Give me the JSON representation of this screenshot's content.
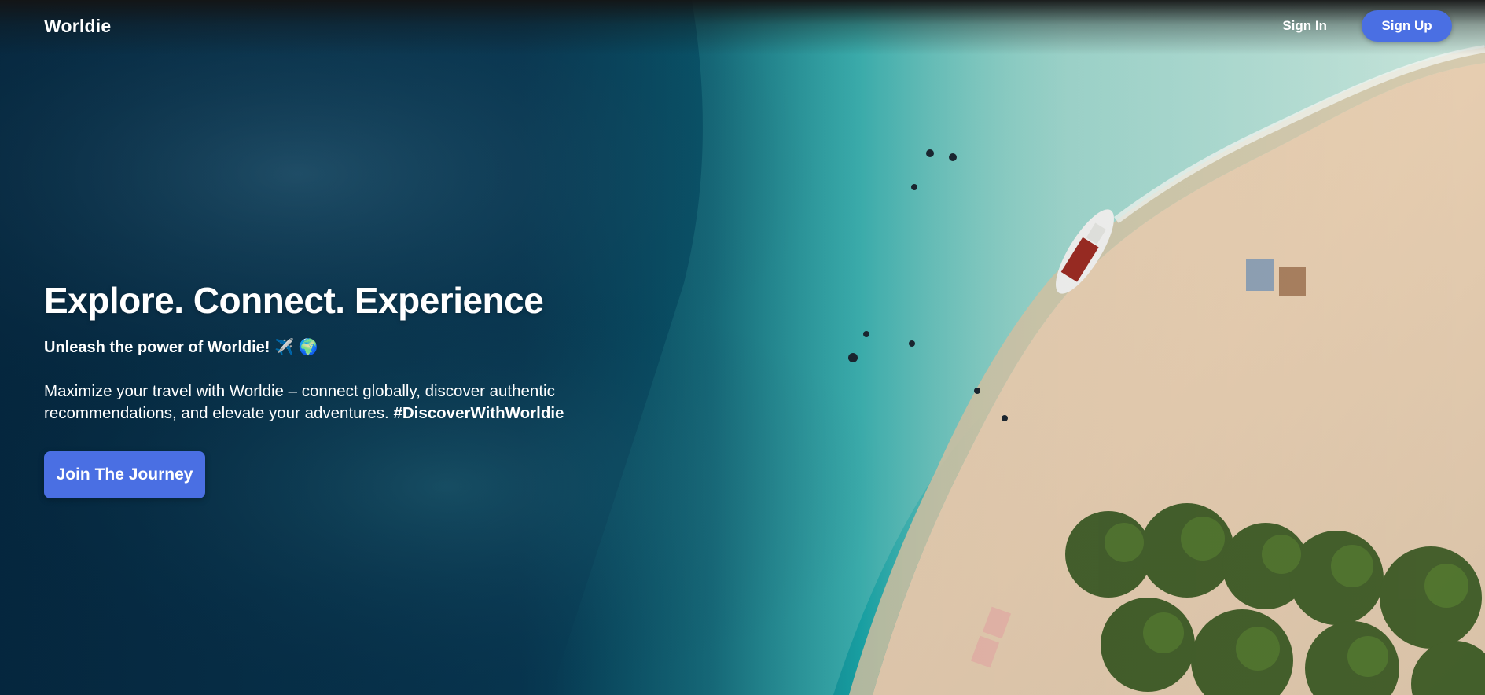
{
  "navbar": {
    "logo": "Worldie",
    "sign_in": "Sign In",
    "sign_up": "Sign Up"
  },
  "hero": {
    "headline": "Explore. Connect. Experience",
    "tagline": "Unleash the power of Worldie! ✈️ 🌍",
    "description": "Maximize your travel with Worldie – connect globally, discover authentic recommendations, and elevate your adventures.",
    "hashtag": "#DiscoverWithWorldie",
    "cta": "Join The Journey"
  },
  "theme": {
    "accent": "#4a6fe3",
    "text": "#ffffff"
  }
}
